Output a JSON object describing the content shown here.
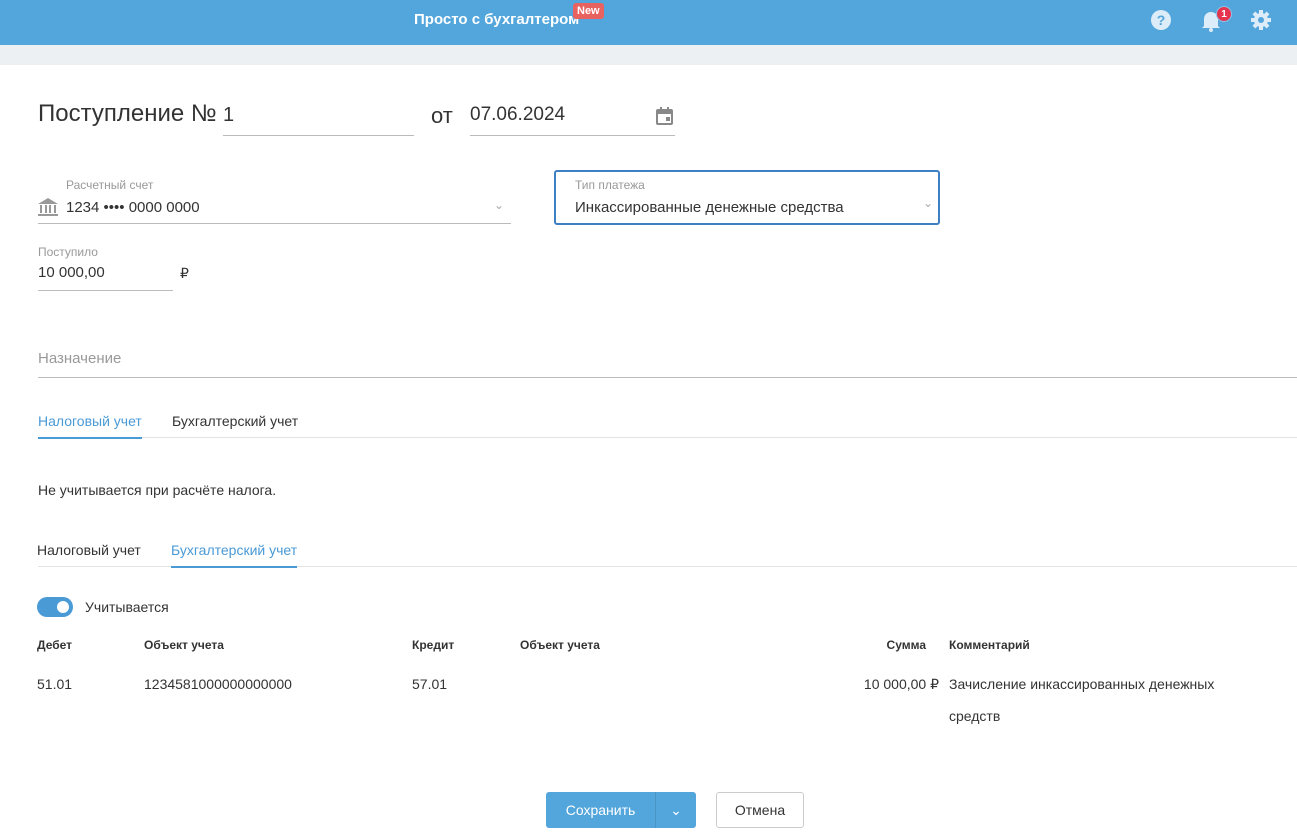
{
  "header": {
    "title": "Просто с бухгалтером",
    "badge": "New",
    "notifications": "1",
    "icons": [
      "help-icon",
      "bell-icon",
      "gear-icon"
    ]
  },
  "doc": {
    "title": "Поступление №",
    "number": "1",
    "from": "от",
    "date": "07.06.2024"
  },
  "account": {
    "label": "Расчетный счет",
    "value": "1234 •••• 0000 0000"
  },
  "payment_type": {
    "label": "Тип платежа",
    "value": "Инкассированные денежные средства"
  },
  "received": {
    "label": "Поступило",
    "value": "10 000,00",
    "currency": "₽"
  },
  "purpose": {
    "placeholder": "Назначение"
  },
  "tabs1": [
    {
      "label": "Налоговый учет"
    },
    {
      "label": "Бухгалтерский учет"
    }
  ],
  "tax_note": "Не учитывается при расчёте налога.",
  "tabs2": [
    {
      "label": "Налоговый учет"
    },
    {
      "label": "Бухгалтерский учет"
    }
  ],
  "toggle": {
    "label": "Учитывается",
    "on": true
  },
  "table": {
    "headers": [
      "Дебет",
      "Объект учета",
      "Кредит",
      "Объект учета",
      "Сумма",
      "Комментарий"
    ],
    "row": [
      "51.01",
      "1234581000000000000",
      "57.01",
      "",
      "10 000,00 ₽",
      "Зачисление инкассированных денежных средств"
    ]
  },
  "buttons": {
    "save": "Сохранить",
    "cancel": "Отмена"
  }
}
